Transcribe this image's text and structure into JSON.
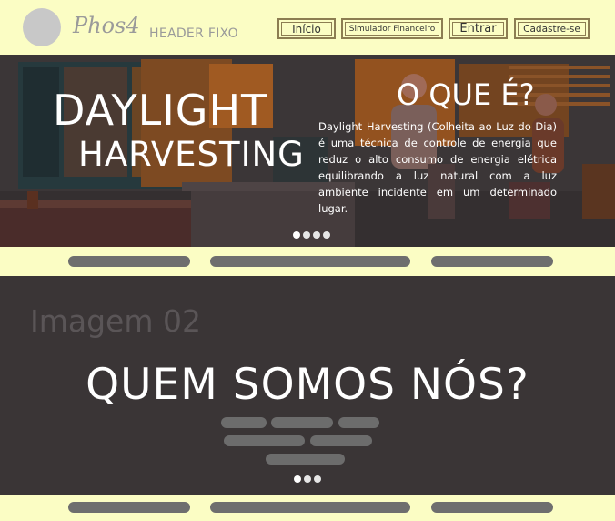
{
  "header": {
    "brand": "Phos4",
    "label": "HEADER FIXO",
    "nav": {
      "inicio": "Início",
      "simulador": "Simulador Financeiro",
      "entrar": "Entrar",
      "cadastre": "Cadastre-se"
    }
  },
  "hero": {
    "title_line1": "DAYLIGHT",
    "title_line2": "HARVESTING",
    "heading": "O QUE É?",
    "text": "Daylight Harvesting (Colheita ao Luz do Dia) é uma técnica de controle de energia que reduz o alto consumo de energia elétrica equilibrando a luz natural com a luz ambiente incidente em um determinado lugar.",
    "slide_count": 4
  },
  "section2": {
    "image_label": "Imagem 02",
    "title": "QUEM SOMOS NÓS?",
    "slide_count": 3
  },
  "colors": {
    "background": "#fbfdc4",
    "dark": "#3a3536",
    "accent_border": "#8c7d52"
  }
}
